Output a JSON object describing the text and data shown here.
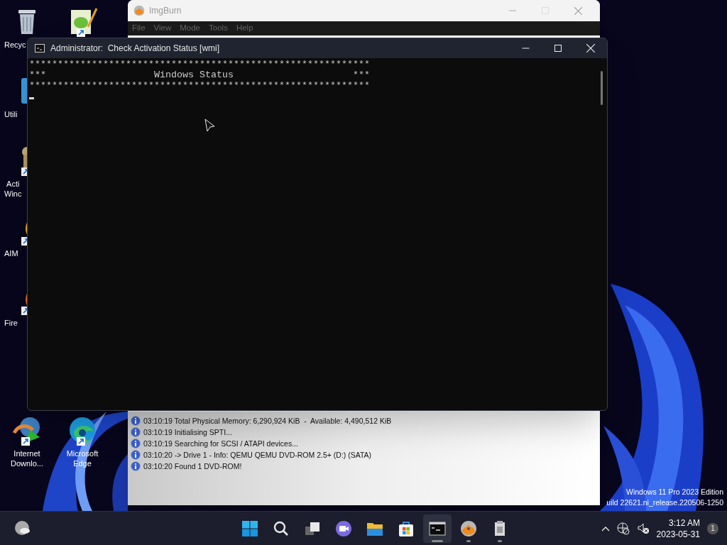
{
  "desktop_icons": [
    {
      "kind": "trash",
      "label": "Recyc"
    },
    {
      "kind": "notepad"
    },
    {
      "kind": "folder",
      "label": "Utili"
    },
    {
      "kind": "key",
      "label": "Acti\nWinc"
    },
    {
      "kind": "aim",
      "label": "AIM"
    },
    {
      "kind": "firefox",
      "label": "Fire"
    },
    {
      "kind": "idm",
      "label": "Internet\nDownlo..."
    },
    {
      "kind": "edge",
      "label": "Microsoft\nEdge"
    }
  ],
  "imgburn_window": {
    "title": "ImgBurn",
    "menu": [
      "File",
      "View",
      "Mode",
      "Tools",
      "Help"
    ],
    "log": [
      "03:10:19 Total Physical Memory: 6,290,924 KiB  -  Available: 4,490,512 KiB",
      "03:10:19 Initialising SPTI...",
      "03:10:19 Searching for SCSI / ATAPI devices...",
      "03:10:20 -> Drive 1 - Info: QEMU QEMU DVD-ROM 2.5+ (D:) (SATA)",
      "03:10:20 Found 1 DVD-ROM!"
    ]
  },
  "console_window": {
    "title": "Administrator:  Check Activation Status [wmi]",
    "lines": [
      "************************************************************",
      "***                   Windows Status                     ***",
      "************************************************************"
    ],
    "cursor": true
  },
  "os_watermark": [
    "Windows 11 Pro 2023 Edition",
    "uild 22621.ni_release.220506-1250"
  ],
  "taskbar": {
    "apps": [
      {
        "kind": "start",
        "selected": false
      },
      {
        "kind": "search",
        "selected": false
      },
      {
        "kind": "taskview",
        "selected": false
      },
      {
        "kind": "chat",
        "selected": false
      },
      {
        "kind": "explorer",
        "selected": false
      },
      {
        "kind": "store",
        "selected": false
      },
      {
        "kind": "terminal",
        "selected": true
      },
      {
        "kind": "disc",
        "selected": false
      },
      {
        "kind": "installer",
        "selected": false
      }
    ],
    "time": "3:12 AM",
    "date": "2023-05-31",
    "notifications": "1"
  }
}
